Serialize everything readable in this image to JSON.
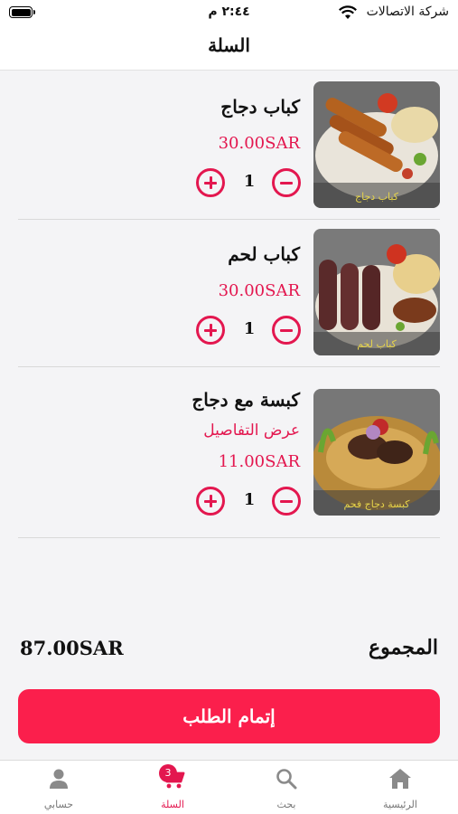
{
  "status_bar": {
    "time": "٢:٤٤ م",
    "carrier": "شركة الاتصالات"
  },
  "header": {
    "title": "السلة"
  },
  "cart": {
    "items": [
      {
        "name": "كباب دجاج",
        "price": "30.00SAR",
        "quantity": "1",
        "image_caption": "كباب دجاج"
      },
      {
        "name": "كباب لحم",
        "price": "30.00SAR",
        "quantity": "1",
        "image_caption": "كباب لحم"
      },
      {
        "name": "كبسة مع دجاج",
        "details_link": "عرض التفاصيل",
        "price": "11.00SAR",
        "quantity": "1",
        "image_caption": "كبسة دجاج فحم"
      }
    ]
  },
  "summary": {
    "total_label": "المجموع",
    "total_value": "87.00SAR"
  },
  "checkout": {
    "label": "إتمام الطلب"
  },
  "tab_bar": {
    "tabs": [
      {
        "label": "الرئيسية",
        "icon": "home-icon"
      },
      {
        "label": "بحث",
        "icon": "search-icon"
      },
      {
        "label": "السلة",
        "icon": "cart-icon",
        "badge": "3",
        "active": true
      },
      {
        "label": "حسابي",
        "icon": "person-icon"
      }
    ]
  },
  "colors": {
    "accent": "#e3174f",
    "button": "#fb1f4c",
    "background": "#f4f4f6"
  }
}
